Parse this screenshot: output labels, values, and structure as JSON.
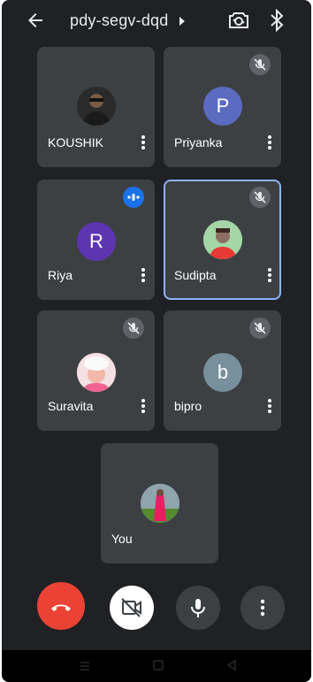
{
  "header": {
    "meeting_code": "pdy-segv-dqd",
    "icons": [
      "back-arrow-icon",
      "caret-right-icon",
      "switch-camera-icon",
      "bluetooth-icon"
    ]
  },
  "participants": [
    {
      "name": "KOUSHIK",
      "avatar": "photo",
      "muted": false,
      "speaking": false
    },
    {
      "name": "Priyanka",
      "avatar_letter": "P",
      "avatar_color": "#5c6bc0",
      "muted": true,
      "speaking": false
    },
    {
      "name": "Riya",
      "avatar_letter": "R",
      "avatar_color": "#5e35b1",
      "muted": false,
      "speaking": true
    },
    {
      "name": "Sudipta",
      "avatar": "photo",
      "muted": true,
      "speaking": false,
      "pinned_highlight": true
    },
    {
      "name": "Suravita",
      "avatar": "photo",
      "muted": true,
      "speaking": false
    },
    {
      "name": "bipro",
      "avatar_letter": "b",
      "avatar_color": "#78909c",
      "muted": true,
      "speaking": false
    },
    {
      "name": "You",
      "avatar": "photo",
      "muted": false,
      "speaking": false
    }
  ],
  "controls": {
    "icons": [
      "end-call-icon",
      "camera-off-icon",
      "microphone-icon",
      "more-options-icon"
    ],
    "end_call_color": "#ea4335"
  },
  "colors": {
    "background": "#202124",
    "tile": "#3c4043",
    "active_border": "#8ab4f8",
    "speaking_badge": "#1a73e8"
  }
}
